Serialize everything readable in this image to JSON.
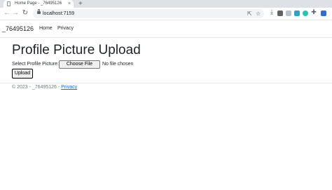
{
  "browser": {
    "tab_title": "Home Page - _76495126",
    "tab_close": "×",
    "new_tab": "+",
    "back": "←",
    "forward": "→",
    "reload": "↻",
    "url": "localhost:7159"
  },
  "navbar": {
    "brand": "_76495126",
    "links": [
      "Home",
      "Privacy"
    ]
  },
  "main": {
    "title": "Profile Picture Upload",
    "file_label": "Select Profile Picture:",
    "file_button": "Choose File",
    "file_status": "No file chosen",
    "upload_button": "Upload"
  },
  "footer": {
    "text": "© 2023 - _76495126 - ",
    "link": "Privacy"
  },
  "colors": {
    "link": "#0d6efd",
    "footer_text": "#6c757d",
    "tab_strip": "#dee1e6"
  }
}
